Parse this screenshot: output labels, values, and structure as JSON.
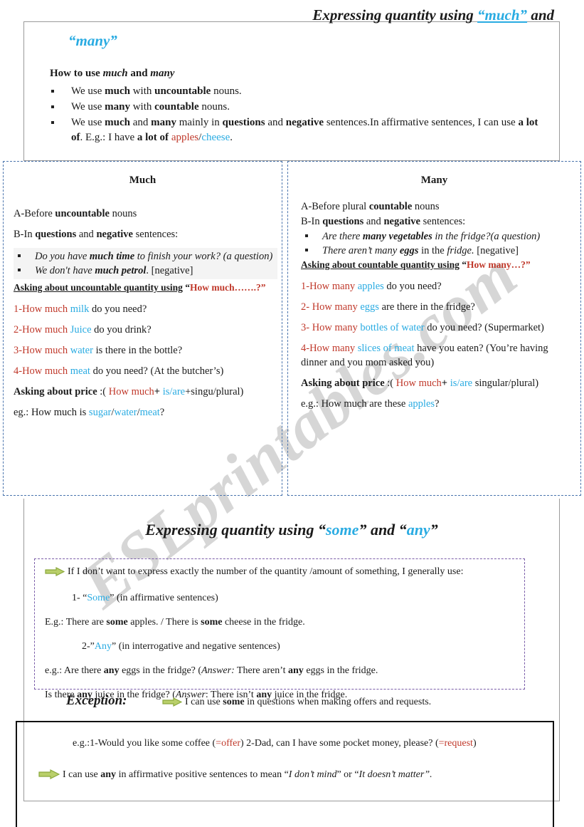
{
  "colors": {
    "cyan": "#29abe2",
    "red": "#c0392b",
    "blue_dash": "#4a74ad",
    "purple_dash": "#7a5ca8",
    "arrow_fill": "#b9cf6a",
    "arrow_stroke": "#8aa83c",
    "gray_highlight": "#f4f4f4"
  },
  "watermark": {
    "text": "ESLprintables.com"
  },
  "title_much_many": {
    "part1": "Expressing quantity using ",
    "quoted1": "“much”",
    "part2": " and",
    "line2": "“many”"
  },
  "intro": {
    "heading_plain": "How to use ",
    "heading_italic1": "much",
    "heading_mid": " and ",
    "heading_italic2": "many",
    "bullets": [
      {
        "segments": [
          {
            "t": "We use ",
            "s": ""
          },
          {
            "t": "much",
            "s": "b"
          },
          {
            "t": " with ",
            "s": ""
          },
          {
            "t": "uncountable",
            "s": "b"
          },
          {
            "t": " nouns.",
            "s": ""
          }
        ]
      },
      {
        "segments": [
          {
            "t": "We use ",
            "s": ""
          },
          {
            "t": "many",
            "s": "b"
          },
          {
            "t": " with ",
            "s": ""
          },
          {
            "t": "countable",
            "s": "b"
          },
          {
            "t": " nouns.",
            "s": ""
          }
        ]
      },
      {
        "segments": [
          {
            "t": "We use ",
            "s": ""
          },
          {
            "t": "much",
            "s": "b"
          },
          {
            "t": " and ",
            "s": ""
          },
          {
            "t": "many",
            "s": "b"
          },
          {
            "t": " mainly in ",
            "s": ""
          },
          {
            "t": "questions",
            "s": "b"
          },
          {
            "t": " and ",
            "s": ""
          },
          {
            "t": "negative",
            "s": "b"
          },
          {
            "t": " sentences.In affirmative sentences, I can use ",
            "s": ""
          },
          {
            "t": "a lot of",
            "s": "b"
          },
          {
            "t": ".  E.g.: I have ",
            "s": ""
          },
          {
            "t": "a lot of ",
            "s": "b"
          },
          {
            "t": "apples",
            "s": "rd"
          },
          {
            "t": "/",
            "s": ""
          },
          {
            "t": "cheese",
            "s": "cy"
          },
          {
            "t": ".",
            "s": ""
          }
        ]
      }
    ]
  },
  "much_column": {
    "title": "Much",
    "rule_a": [
      {
        "t": "A-Before ",
        "s": ""
      },
      {
        "t": "uncountable",
        "s": "b"
      },
      {
        "t": " nouns",
        "s": ""
      }
    ],
    "rule_b": [
      {
        "t": "B-In ",
        "s": ""
      },
      {
        "t": "questions",
        "s": "b"
      },
      {
        "t": " and ",
        "s": ""
      },
      {
        "t": "negative",
        "s": "b"
      },
      {
        "t": " sentences:",
        "s": ""
      }
    ],
    "examples": [
      [
        {
          "t": "Do you have ",
          "s": "i"
        },
        {
          "t": "much time",
          "s": "b i"
        },
        {
          "t": " to finish your work? (a question)",
          "s": "i"
        }
      ],
      [
        {
          "t": "We don't have ",
          "s": "i"
        },
        {
          "t": "much petrol",
          "s": "b i"
        },
        {
          "t": ". [negative]",
          "s": ""
        }
      ]
    ],
    "asking_head": [
      {
        "t": "Asking about uncountable quantity using",
        "s": "b ul"
      },
      {
        "t": " “",
        "s": ""
      },
      {
        "t": "How much…….?”",
        "s": "rd"
      }
    ],
    "questions": [
      [
        {
          "t": "1-How much ",
          "s": "rd"
        },
        {
          "t": "milk",
          "s": "cy"
        },
        {
          "t": " do you need?",
          "s": ""
        }
      ],
      [
        {
          "t": "2-How much ",
          "s": "rd"
        },
        {
          "t": "Juice",
          "s": "cy"
        },
        {
          "t": " do you drink?",
          "s": ""
        }
      ],
      [
        {
          "t": "3-How much ",
          "s": "rd"
        },
        {
          "t": "water",
          "s": "cy"
        },
        {
          "t": " is there in the bottle?",
          "s": ""
        }
      ],
      [
        {
          "t": "4-How much ",
          "s": "rd"
        },
        {
          "t": "meat",
          "s": "cy"
        },
        {
          "t": " do you need? (At the butcher’s)",
          "s": ""
        }
      ]
    ],
    "price_line": [
      {
        "t": "Asking about price",
        "s": "b"
      },
      {
        "t": " :( ",
        "s": ""
      },
      {
        "t": "How much",
        "s": "rd"
      },
      {
        "t": "+ ",
        "s": "b"
      },
      {
        "t": "is/are",
        "s": "cy"
      },
      {
        "t": "+singu/plural)",
        "s": ""
      }
    ],
    "price_example": [
      {
        "t": "eg.: How much is ",
        "s": ""
      },
      {
        "t": "sugar",
        "s": "cy"
      },
      {
        "t": "/",
        "s": ""
      },
      {
        "t": "water",
        "s": "cy"
      },
      {
        "t": "/",
        "s": ""
      },
      {
        "t": "meat",
        "s": "cy"
      },
      {
        "t": "?",
        "s": ""
      }
    ]
  },
  "many_column": {
    "title": "Many",
    "rule_a": [
      {
        "t": "A-Before plural ",
        "s": ""
      },
      {
        "t": "countable",
        "s": "b"
      },
      {
        "t": " nouns",
        "s": ""
      }
    ],
    "rule_b": [
      {
        "t": "B-In ",
        "s": ""
      },
      {
        "t": "questions",
        "s": "b"
      },
      {
        "t": " and ",
        "s": ""
      },
      {
        "t": "negative",
        "s": "b"
      },
      {
        "t": " sentences:",
        "s": ""
      }
    ],
    "examples": [
      [
        {
          "t": "Are there ",
          "s": "i"
        },
        {
          "t": "many vegetables",
          "s": "b i"
        },
        {
          "t": " in the fridge?(a question)",
          "s": "i"
        }
      ],
      [
        {
          "t": "There aren’t many ",
          "s": "i"
        },
        {
          "t": "eggs",
          "s": "b i"
        },
        {
          "t": " in the ",
          "s": ""
        },
        {
          "t": "fridge.",
          "s": "i"
        },
        {
          "t": " [negative]",
          "s": ""
        }
      ]
    ],
    "asking_head": [
      {
        "t": "Asking about countable quantity using",
        "s": "b ul"
      },
      {
        "t": " “",
        "s": ""
      },
      {
        "t": "How many…?”",
        "s": "rd"
      }
    ],
    "questions": [
      [
        {
          "t": "1-How many ",
          "s": "rd"
        },
        {
          "t": "apples",
          "s": "cy"
        },
        {
          "t": " do you need?",
          "s": ""
        }
      ],
      [
        {
          "t": "2- How many ",
          "s": "rd"
        },
        {
          "t": "eggs",
          "s": "cy"
        },
        {
          "t": " are there in the fridge?",
          "s": ""
        }
      ],
      [
        {
          "t": "3- How many ",
          "s": "rd"
        },
        {
          "t": "bottles of water",
          "s": "cy"
        },
        {
          "t": " do you need? (Supermarket)",
          "s": ""
        }
      ],
      [
        {
          "t": "4-How many ",
          "s": "rd"
        },
        {
          "t": "slices of meat",
          "s": "cy"
        },
        {
          "t": " have you eaten? (You’re having dinner and you mom asked you)",
          "s": ""
        }
      ]
    ],
    "price_line": [
      {
        "t": "Asking about price",
        "s": "b"
      },
      {
        "t": " :( ",
        "s": ""
      },
      {
        "t": "How much",
        "s": "rd"
      },
      {
        "t": "+ ",
        "s": "b"
      },
      {
        "t": "is/are",
        "s": "cy"
      },
      {
        "t": " singular/plural)",
        "s": ""
      }
    ],
    "price_example": [
      {
        "t": "e.g.: How much are these ",
        "s": ""
      },
      {
        "t": "apples",
        "s": "cy"
      },
      {
        "t": "?",
        "s": ""
      }
    ]
  },
  "title_some_any": {
    "part1": "Expressing quantity using “",
    "quoted1": "some",
    "part2": "” and “",
    "quoted2": "any",
    "part3": "”"
  },
  "some_any": {
    "lead": [
      {
        "t": "If I don’t want to express exactly the number of the quantity /amount of something, I generally use:",
        "s": ""
      }
    ],
    "item1": [
      {
        "t": "1- “",
        "s": ""
      },
      {
        "t": "Some",
        "s": "cy"
      },
      {
        "t": "” (in affirmative sentences)",
        "s": ""
      }
    ],
    "item1_example": [
      {
        "t": "E.g.: There are ",
        "s": ""
      },
      {
        "t": "some",
        "s": "b"
      },
      {
        "t": " apples.   /   There is ",
        "s": ""
      },
      {
        "t": "some",
        "s": "b"
      },
      {
        "t": " cheese in the fridge.",
        "s": ""
      }
    ],
    "item2": [
      {
        "t": "2-”",
        "s": ""
      },
      {
        "t": "Any",
        "s": "cy"
      },
      {
        "t": "” (in interrogative and negative sentences)",
        "s": ""
      }
    ],
    "item2_example1": [
      {
        "t": "e.g.: Are there ",
        "s": ""
      },
      {
        "t": "any",
        "s": "b"
      },
      {
        "t": " eggs in the fridge? (",
        "s": ""
      },
      {
        "t": "Answer:",
        "s": "i"
      },
      {
        "t": " There aren’t ",
        "s": ""
      },
      {
        "t": "any",
        "s": "b"
      },
      {
        "t": " eggs in the fridge.",
        "s": ""
      }
    ],
    "item2_example2": [
      {
        "t": "Is there ",
        "s": ""
      },
      {
        "t": "any",
        "s": "b"
      },
      {
        "t": " juice in the fridge? (",
        "s": ""
      },
      {
        "t": "Answer",
        "s": "i"
      },
      {
        "t": ": There isn’t ",
        "s": ""
      },
      {
        "t": "any",
        "s": "b"
      },
      {
        "t": " juice in the fridge.",
        "s": ""
      }
    ]
  },
  "exception": {
    "label": "Exception:",
    "headline": [
      {
        "t": "I can use ",
        "s": ""
      },
      {
        "t": "some",
        "s": "b"
      },
      {
        "t": "  in questions when making offers and requests.",
        "s": ""
      }
    ],
    "line1": [
      {
        "t": "e.g.:1-Would you like some coffee (",
        "s": ""
      },
      {
        "t": "=offer",
        "s": "rd"
      },
      {
        "t": ") 2-Dad, can I have some pocket money, please? (",
        "s": ""
      },
      {
        "t": "=request",
        "s": "rd"
      },
      {
        "t": ")",
        "s": ""
      }
    ],
    "line2": [
      {
        "t": "I can use ",
        "s": ""
      },
      {
        "t": "any",
        "s": "b"
      },
      {
        "t": " in affirmative positive sentences to mean “",
        "s": ""
      },
      {
        "t": "I don’t mind",
        "s": "i"
      },
      {
        "t": "” or “",
        "s": ""
      },
      {
        "t": "It doesn’t matter”.",
        "s": "i"
      }
    ]
  }
}
